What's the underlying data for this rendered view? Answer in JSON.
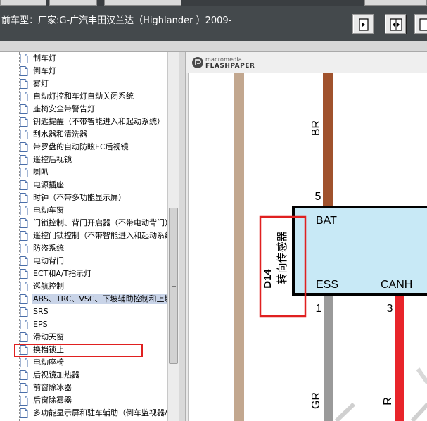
{
  "header": {
    "vehicle_title": "前车型：厂家:G-广汽丰田汉兰达（Highlander ）2009-"
  },
  "toolbar": {
    "buttons": [
      {
        "name": "single-page-view",
        "icon": "single-page-icon"
      },
      {
        "name": "two-page-view",
        "icon": "two-page-icon"
      },
      {
        "name": "next-view",
        "icon": "next-page-icon"
      }
    ]
  },
  "tree": {
    "items": [
      {
        "label": "制车灯"
      },
      {
        "label": "倒车灯"
      },
      {
        "label": "雾灯"
      },
      {
        "label": "自动灯控和车灯自动关闭系统"
      },
      {
        "label": "座椅安全带警告灯"
      },
      {
        "label": "钥匙提醒（不带智能进入和起动系统）"
      },
      {
        "label": "刮水器和清洗器"
      },
      {
        "label": "带罗盘的自动防眩EC后视镜"
      },
      {
        "label": "遥控后视镜"
      },
      {
        "label": "喇叭"
      },
      {
        "label": "电源插座"
      },
      {
        "label": "时钟（不带多功能显示屏）"
      },
      {
        "label": "电动车窗"
      },
      {
        "label": "门锁控制、背门开启器（不带电动背门）"
      },
      {
        "label": "遥控门锁控制（不带智能进入和起动系统）"
      },
      {
        "label": "防盗系统"
      },
      {
        "label": "电动背门"
      },
      {
        "label": "ECT和A/T指示灯"
      },
      {
        "label": "巡航控制"
      },
      {
        "label": "ABS、TRC、VSC、下坡辅助控制和上坡"
      },
      {
        "label": "SRS"
      },
      {
        "label": "EPS"
      },
      {
        "label": "滑动天窗"
      },
      {
        "label": "换档锁止"
      },
      {
        "label": "电动座椅"
      },
      {
        "label": "后视镜加热器"
      },
      {
        "label": "前窗除冰器"
      },
      {
        "label": "后窗除雾器"
      },
      {
        "label": "多功能显示屏和驻车辅助（倒车监视器/"
      }
    ],
    "selected_index": 19
  },
  "viewer": {
    "brand_top": "macromedia",
    "brand_bottom": "FLASHPAPER"
  },
  "diagram": {
    "connector_id": "D14",
    "component_name": "转向传感器",
    "pins": {
      "bat": "BAT",
      "ess": "ESS",
      "canh": "CANH"
    },
    "pin_numbers": {
      "bat": "5",
      "ess": "1",
      "canh": "3"
    },
    "wire_colors": {
      "bat": "BR",
      "ess": "GR",
      "canh": "R"
    },
    "colors": {
      "component_fill": "#c8e9f6",
      "wire_brown": "#a0522d",
      "wire_gray": "#9a9a9a",
      "wire_red": "#e8242a",
      "wire_tan": "#c2a78f",
      "highlight_red": "#e02020"
    }
  }
}
